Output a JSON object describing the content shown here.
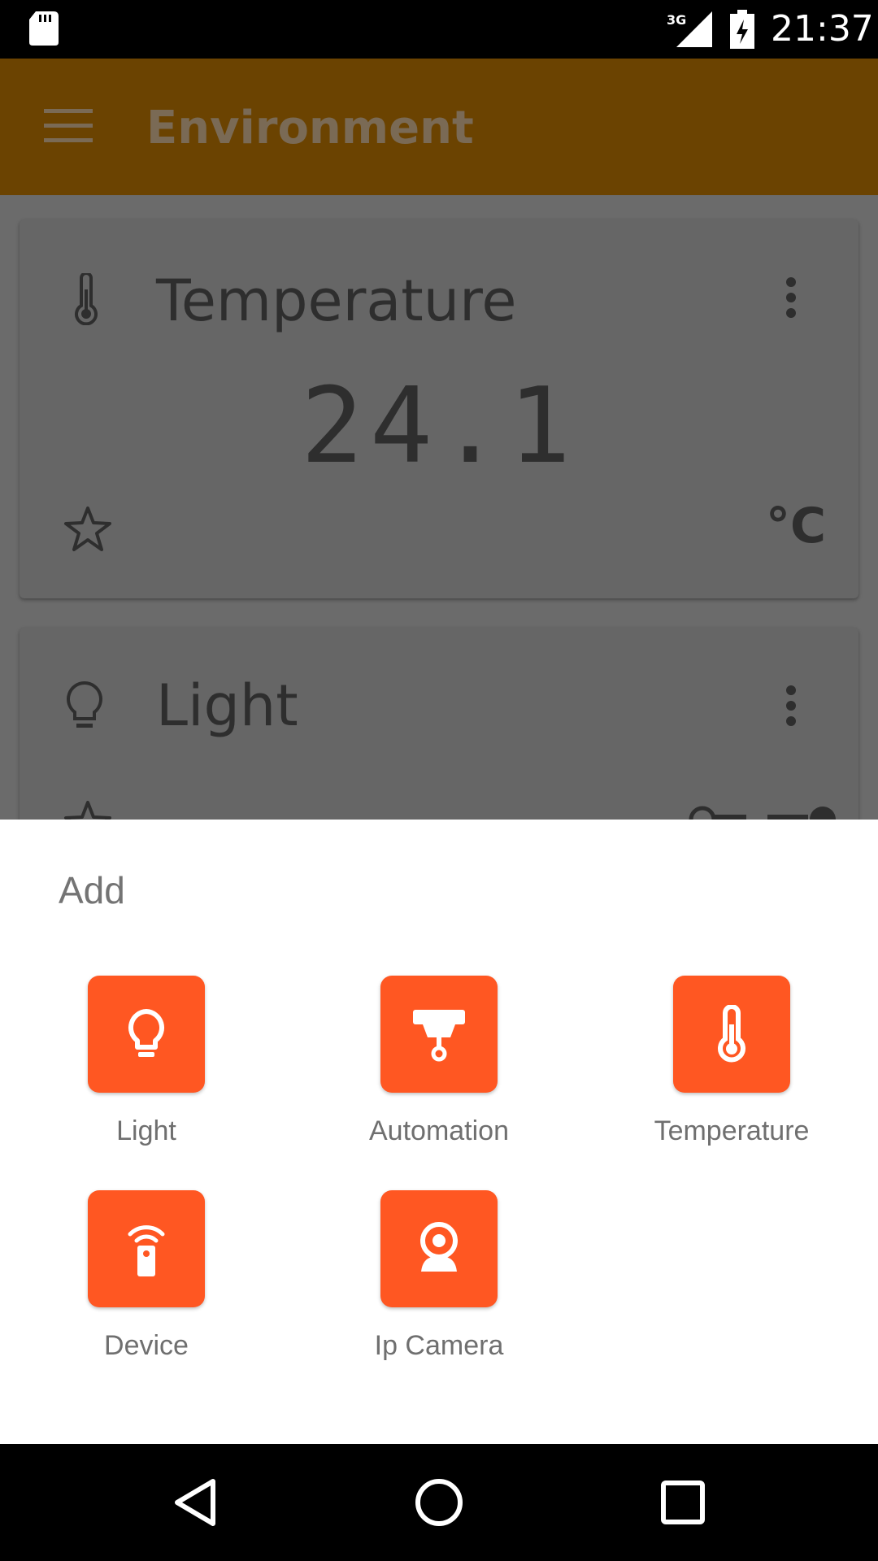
{
  "status_bar": {
    "time": "21:37",
    "network": "3G"
  },
  "app_bar": {
    "title": "Environment"
  },
  "cards": {
    "temperature": {
      "title": "Temperature",
      "value": "24.1",
      "unit": "°C"
    },
    "light": {
      "title": "Light"
    }
  },
  "sheet": {
    "title": "Add",
    "items": [
      {
        "label": "Light",
        "icon": "lightbulb-icon"
      },
      {
        "label": "Automation",
        "icon": "automation-icon"
      },
      {
        "label": "Temperature",
        "icon": "thermometer-icon"
      },
      {
        "label": "Device",
        "icon": "remote-device-icon"
      },
      {
        "label": "Ip Camera",
        "icon": "webcam-icon"
      }
    ]
  },
  "colors": {
    "accent": "#ff5722",
    "app_bar": "#6b4301",
    "scrim_bg": "#6b6b6b"
  }
}
